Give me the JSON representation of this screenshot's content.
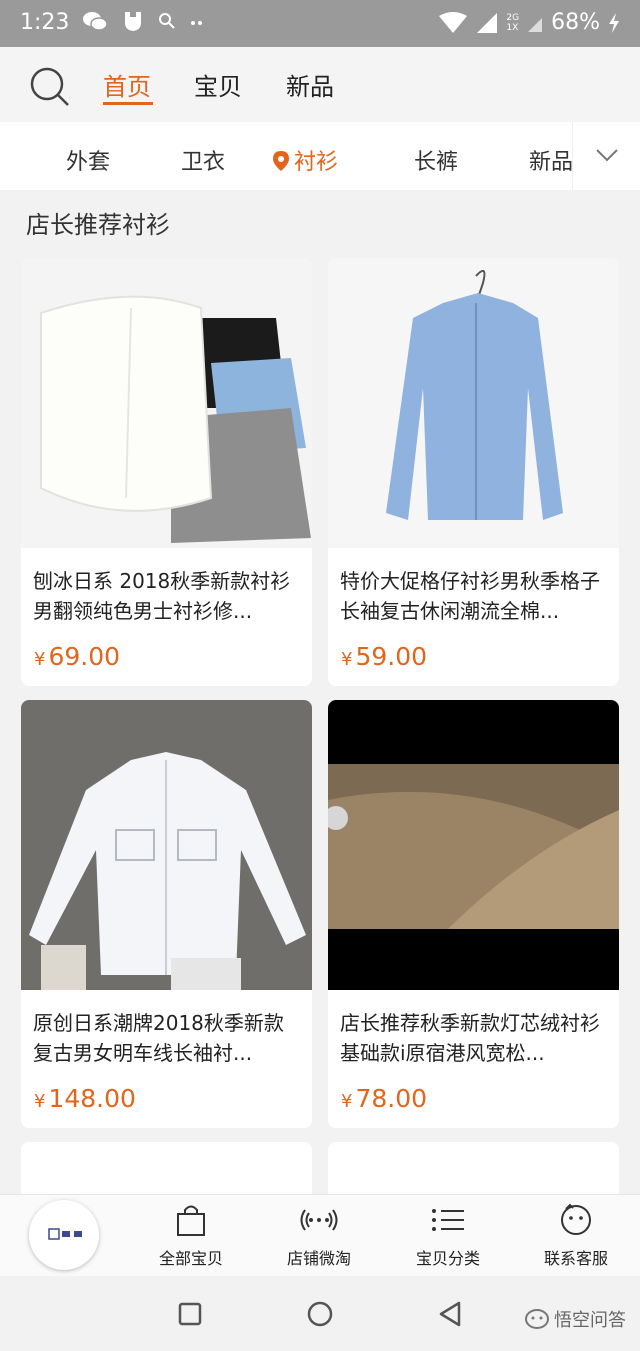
{
  "status_bar": {
    "time": "1:23",
    "battery": "68%",
    "network_2g": "2G",
    "network_1x": "1X"
  },
  "header": {
    "tabs": [
      {
        "label": "首页",
        "active": true
      },
      {
        "label": "宝贝",
        "active": false
      },
      {
        "label": "新品",
        "active": false
      }
    ]
  },
  "categories": {
    "items": [
      "外套",
      "卫衣",
      "衬衫",
      "长裤",
      "新品"
    ],
    "active": "衬衫"
  },
  "section": {
    "title": "店长推荐衬衫"
  },
  "products": [
    {
      "title": "刨冰日系 2018秋季新款衬衫男翻领纯色男士衬衫修...",
      "currency": "¥",
      "price": "69.00"
    },
    {
      "title": "特价大促格仔衬衫男秋季格子长袖复古休闲潮流全棉...",
      "currency": "¥",
      "price": "59.00"
    },
    {
      "title": "原创日系潮牌2018秋季新款复古男女明车线长袖衬...",
      "currency": "¥",
      "price": "148.00"
    },
    {
      "title": "店长推荐秋季新款灯芯绒衬衫基础款i原宿港风宽松...",
      "currency": "¥",
      "price": "78.00"
    }
  ],
  "bottom_nav": {
    "items": [
      {
        "label": "全部宝贝",
        "icon": "shopping-bag-icon"
      },
      {
        "label": "店铺微淘",
        "icon": "broadcast-icon"
      },
      {
        "label": "宝贝分类",
        "icon": "list-icon"
      },
      {
        "label": "联系客服",
        "icon": "chat-face-icon"
      }
    ]
  },
  "watermark": {
    "text": "悟空问答"
  },
  "colors": {
    "accent": "#e2651b",
    "status_bar": "#9a9a9a"
  }
}
